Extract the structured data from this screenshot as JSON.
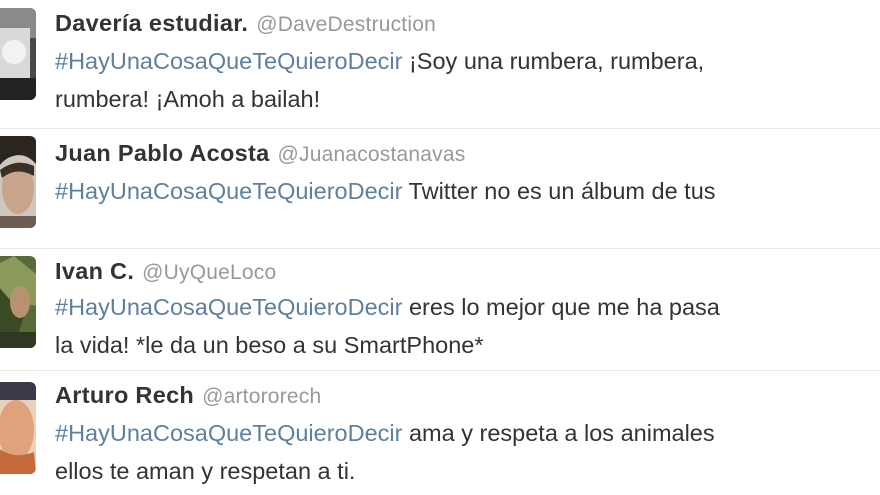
{
  "tweets": [
    {
      "fullname": "Davería estudiar.",
      "username": "@DaveDestruction",
      "hashtag": "#HayUnaCosaQueTeQuieroDecir",
      "line1_rest": " ¡Soy una rumbera, rumbera,",
      "line2": "rumbera! ¡Amoh a bailah!"
    },
    {
      "fullname": "Juan Pablo Acosta",
      "username": "@Juanacostanavas",
      "hashtag": "#HayUnaCosaQueTeQuieroDecir",
      "line1_rest": " Twitter no es un álbum de tus",
      "line2": ""
    },
    {
      "fullname": "Ivan C.",
      "username": "@UyQueLoco",
      "hashtag": "#HayUnaCosaQueTeQuieroDecir",
      "line1_rest": " eres lo mejor que me ha pasa",
      "line2": "la vida! *le da un beso a su SmartPhone*"
    },
    {
      "fullname": "Arturo Rech",
      "username": "@artororech",
      "hashtag": "#HayUnaCosaQueTeQuieroDecir",
      "line1_rest": " ama y respeta a los animales",
      "line2": "ellos te aman y respetan a ti."
    }
  ],
  "colors": {
    "text": "#333333",
    "username": "#999999",
    "hashtag": "#5e7f9e",
    "background": "#ffffff"
  },
  "icons": [
    "avatar-photo"
  ]
}
